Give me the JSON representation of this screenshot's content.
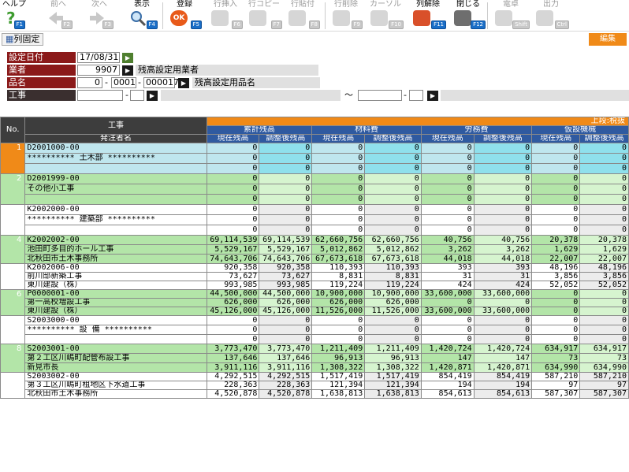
{
  "toolbar": {
    "help": "ヘルプ",
    "help_key": "F1",
    "prev": "前へ",
    "prev_key": "F2",
    "next": "次へ",
    "next_key": "F3",
    "view": "表示",
    "view_key": "F4",
    "register": "登録",
    "register_key": "F5",
    "row_insert": "行挿入",
    "row_insert_key": "F6",
    "row_copy": "行コピー",
    "row_copy_key": "F7",
    "row_paste": "行貼付",
    "row_paste_key": "F8",
    "row_delete": "行削除",
    "row_delete_key": "F9",
    "cursor": "カーソル",
    "cursor_key": "F10",
    "col_unfix": "列解除",
    "col_unfix_key": "F11",
    "close": "閉じる",
    "close_key": "F12",
    "calc": "電卓",
    "calc_key": "Shift",
    "output": "出力",
    "output_key": "Ctrl"
  },
  "fix_column_label": "列固定",
  "edit_label": "編集",
  "form": {
    "date_label": "設定日付",
    "date_value": "17/08/31",
    "vendor_label": "業者",
    "vendor_code": "9907",
    "vendor_name": "残高設定用業者",
    "item_label": "品名",
    "item_code1": "0",
    "item_code2": "0001",
    "item_code3": "000017",
    "item_name": "残高設定用品名",
    "work_label": "工事",
    "dash": "-",
    "tilde": "～"
  },
  "grid": {
    "no_header": "No.",
    "work_header": "工事",
    "client_header": "発注者名",
    "top_note": "上段:税抜",
    "groups": [
      "累計残高",
      "材料費",
      "労務費",
      "仮設機械"
    ],
    "sub_current": "現在残高",
    "sub_adjusted": "調整後残高",
    "rows": [
      {
        "no": "1",
        "l1": "D2001000-00",
        "l2": "********** 土木部 **********",
        "l3": "",
        "v": [
          [
            "0",
            "0",
            "0"
          ],
          [
            "0",
            "0",
            "0"
          ],
          [
            "0",
            "0",
            "0"
          ],
          [
            "0",
            "0",
            "0"
          ],
          [
            "0",
            "0",
            "0"
          ],
          [
            "0",
            "0",
            "0"
          ],
          [
            "0",
            "0",
            "0"
          ],
          [
            "0",
            "0",
            "0"
          ]
        ]
      },
      {
        "no": "2",
        "l1": "D2001999-00",
        "l2": "その他小工事",
        "l3": "",
        "v": [
          [
            "0",
            "0",
            "0"
          ],
          [
            "0",
            "0",
            "0"
          ],
          [
            "0",
            "0",
            "0"
          ],
          [
            "0",
            "0",
            "0"
          ],
          [
            "0",
            "0",
            "0"
          ],
          [
            "0",
            "0",
            "0"
          ],
          [
            "0",
            "0",
            "0"
          ],
          [
            "0",
            "0",
            "0"
          ]
        ]
      },
      {
        "no": "3",
        "l1": "K2002000-00",
        "l2": "********** 建築部 **********",
        "l3": "",
        "v": [
          [
            "0",
            "0",
            "0"
          ],
          [
            "0",
            "0",
            "0"
          ],
          [
            "0",
            "0",
            "0"
          ],
          [
            "0",
            "0",
            "0"
          ],
          [
            "0",
            "0",
            "0"
          ],
          [
            "0",
            "0",
            "0"
          ],
          [
            "0",
            "0",
            "0"
          ],
          [
            "0",
            "0",
            "0"
          ]
        ]
      },
      {
        "no": "4",
        "l1": "K2002002-00",
        "l2": "池田町多目的ホール工事",
        "l3": "北秋田市土木事務所",
        "v": [
          [
            "69,114,539",
            "5,529,167",
            "74,643,706"
          ],
          [
            "69,114,539",
            "5,529,167",
            "74,643,706"
          ],
          [
            "62,660,756",
            "5,012,862",
            "67,673,618"
          ],
          [
            "62,660,756",
            "5,012,862",
            "67,673,618"
          ],
          [
            "40,756",
            "3,262",
            "44,018"
          ],
          [
            "40,756",
            "3,262",
            "44,018"
          ],
          [
            "20,378",
            "1,629",
            "22,007"
          ],
          [
            "20,378",
            "1,629",
            "22,007"
          ]
        ]
      },
      {
        "no": "5",
        "l1": "K2002006-00",
        "l2": "前川邸新築工事",
        "l3": "東川建設（株）",
        "v": [
          [
            "920,358",
            "73,627",
            "993,985"
          ],
          [
            "920,358",
            "73,627",
            "993,985"
          ],
          [
            "110,393",
            "8,831",
            "119,224"
          ],
          [
            "110,393",
            "8,831",
            "119,224"
          ],
          [
            "393",
            "31",
            "424"
          ],
          [
            "393",
            "31",
            "424"
          ],
          [
            "48,196",
            "3,856",
            "52,052"
          ],
          [
            "48,196",
            "3,856",
            "52,052"
          ]
        ]
      },
      {
        "no": "6",
        "l1": "P0000001-00",
        "l2": "第一高校増設工事",
        "l3": "東川建設（株）",
        "v": [
          [
            "44,500,000",
            "626,000",
            "45,126,000"
          ],
          [
            "44,500,000",
            "626,000",
            "45,126,000"
          ],
          [
            "10,900,000",
            "626,000",
            "11,526,000"
          ],
          [
            "10,900,000",
            "626,000",
            "11,526,000"
          ],
          [
            "33,600,000",
            "0",
            "33,600,000"
          ],
          [
            "33,600,000",
            "0",
            "33,600,000"
          ],
          [
            "0",
            "0",
            "0"
          ],
          [
            "0",
            "0",
            "0"
          ]
        ]
      },
      {
        "no": "7",
        "l1": "S2003000-00",
        "l2": "********** 設 備 **********",
        "l3": "",
        "v": [
          [
            "0",
            "0",
            "0"
          ],
          [
            "0",
            "0",
            "0"
          ],
          [
            "0",
            "0",
            "0"
          ],
          [
            "0",
            "0",
            "0"
          ],
          [
            "0",
            "0",
            "0"
          ],
          [
            "0",
            "0",
            "0"
          ],
          [
            "0",
            "0",
            "0"
          ],
          [
            "0",
            "0",
            "0"
          ]
        ]
      },
      {
        "no": "8",
        "l1": "S2003001-00",
        "l2": "第２工区川嶋町配管布設工事",
        "l3": "新見市長",
        "v": [
          [
            "3,773,470",
            "137,646",
            "3,911,116"
          ],
          [
            "3,773,470",
            "137,646",
            "3,911,116"
          ],
          [
            "1,211,409",
            "96,913",
            "1,308,322"
          ],
          [
            "1,211,409",
            "96,913",
            "1,308,322"
          ],
          [
            "1,420,724",
            "147",
            "1,420,871"
          ],
          [
            "1,420,724",
            "147",
            "1,420,871"
          ],
          [
            "634,917",
            "73",
            "634,990"
          ],
          [
            "634,917",
            "73",
            "634,990"
          ]
        ]
      },
      {
        "no": "9",
        "l1": "S2003002-00",
        "l2": "第３工区川嶋町租地区下水道工事",
        "l3": "北秋田市土木事務所",
        "v": [
          [
            "4,292,515",
            "228,363",
            "4,520,878"
          ],
          [
            "4,292,515",
            "228,363",
            "4,520,878"
          ],
          [
            "1,517,419",
            "121,394",
            "1,638,813"
          ],
          [
            "1,517,419",
            "121,394",
            "1,638,813"
          ],
          [
            "854,419",
            "194",
            "854,613"
          ],
          [
            "854,419",
            "194",
            "854,613"
          ],
          [
            "587,210",
            "97",
            "587,307"
          ],
          [
            "587,210",
            "97",
            "587,307"
          ]
        ]
      }
    ]
  },
  "colors": {
    "orange": "#f08a18",
    "header_blue": "#2f5aa0",
    "label_red": "#8b1a1a",
    "cyan_row": "#bfe6ee",
    "green_row": "#b3e5a8"
  }
}
